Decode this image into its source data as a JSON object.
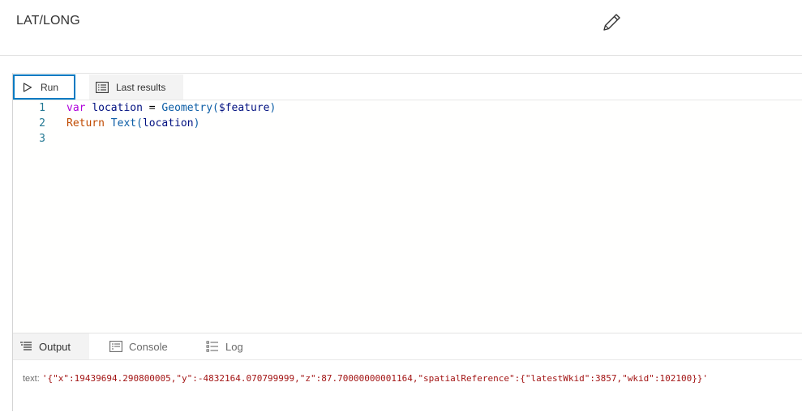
{
  "header": {
    "title": "LAT/LONG",
    "edit_icon": "pencil-icon"
  },
  "toolbar": {
    "run_label": "Run",
    "run_icon": "play-icon",
    "last_results_label": "Last results",
    "last_results_icon": "results-list-icon",
    "accent_color": "#007ac2"
  },
  "editor": {
    "lines": [
      {
        "number": "1",
        "tokens": [
          {
            "text": "var",
            "kind": "kw"
          },
          {
            "text": " ",
            "kind": "plain"
          },
          {
            "text": "location",
            "kind": "var"
          },
          {
            "text": " = ",
            "kind": "plain"
          },
          {
            "text": "Geometry",
            "kind": "fn"
          },
          {
            "text": "(",
            "kind": "fn"
          },
          {
            "text": "$feature",
            "kind": "var"
          },
          {
            "text": ")",
            "kind": "fn"
          }
        ]
      },
      {
        "number": "2",
        "tokens": [
          {
            "text": "Return",
            "kind": "kw2"
          },
          {
            "text": " ",
            "kind": "plain"
          },
          {
            "text": "Text",
            "kind": "fn"
          },
          {
            "text": "(",
            "kind": "fn"
          },
          {
            "text": "location",
            "kind": "var"
          },
          {
            "text": ")",
            "kind": "fn"
          }
        ]
      },
      {
        "number": "3",
        "tokens": []
      }
    ]
  },
  "output_panel": {
    "tabs": [
      {
        "label": "Output",
        "icon": "output-list-icon",
        "active": true
      },
      {
        "label": "Console",
        "icon": "console-icon",
        "active": false
      },
      {
        "label": "Log",
        "icon": "log-list-icon",
        "active": false
      }
    ],
    "result_key": "text:",
    "result_value": "'{\"x\":19439694.290800005,\"y\":-4832164.070799999,\"z\":87.70000000001164,\"spatialReference\":{\"latestWkid\":3857,\"wkid\":102100}}'"
  }
}
